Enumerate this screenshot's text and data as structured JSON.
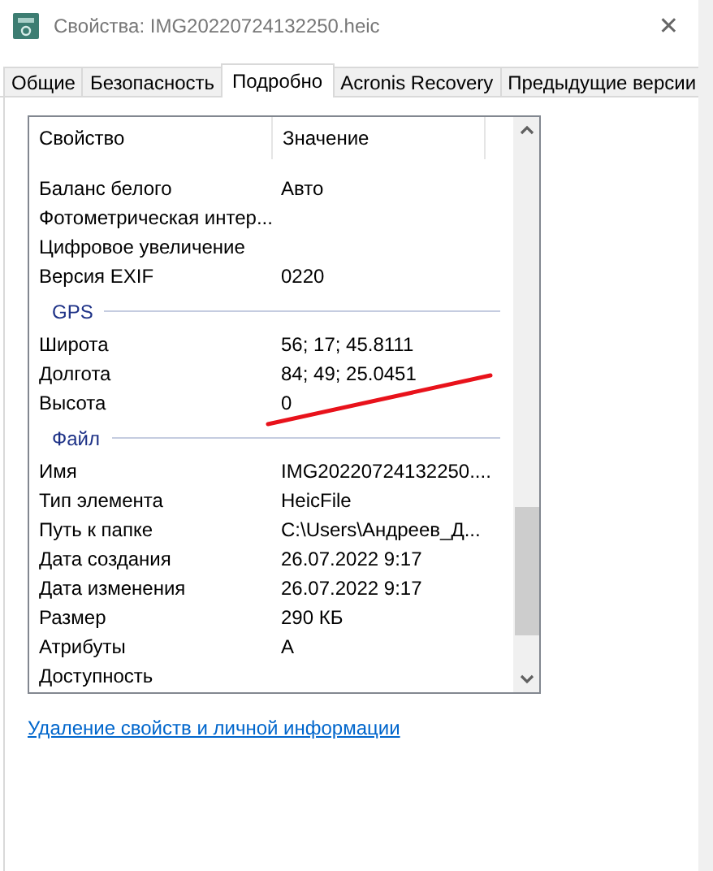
{
  "window": {
    "title": "Свойства: IMG20220724132250.heic",
    "close": "✕"
  },
  "tabs": [
    {
      "label": "Общие",
      "selected": false
    },
    {
      "label": "Безопасность",
      "selected": false
    },
    {
      "label": "Подробно",
      "selected": true
    },
    {
      "label": "Acronis Recovery",
      "selected": false
    },
    {
      "label": "Предыдущие версии",
      "selected": false
    }
  ],
  "list": {
    "columns": [
      "Свойство",
      "Значение"
    ],
    "groups": [
      {
        "rows": [
          {
            "property": "Баланс белого",
            "value": "Авто"
          },
          {
            "property": "Фотометрическая интер..."
          },
          {
            "property": "Цифровое увеличение"
          },
          {
            "property": "Версия EXIF",
            "value": "0220"
          }
        ]
      },
      {
        "name": "GPS",
        "rows": [
          {
            "property": "Широта",
            "value": "56; 17; 45.8111"
          },
          {
            "property": "Долгота",
            "value": "84; 49; 25.0451"
          },
          {
            "property": "Высота",
            "value": "0"
          }
        ]
      },
      {
        "name": "Файл",
        "rows": [
          {
            "property": "Имя",
            "value": "IMG20220724132250...."
          },
          {
            "property": "Тип элемента",
            "value": "HeicFile"
          },
          {
            "property": "Путь к папке",
            "value": "C:\\Users\\Андреев_Д..."
          },
          {
            "property": "Дата создания",
            "value": "26.07.2022 9:17"
          },
          {
            "property": "Дата изменения",
            "value": "26.07.2022 9:17"
          },
          {
            "property": "Размер",
            "value": "290 КБ"
          },
          {
            "property": "Атрибуты",
            "value": "A"
          },
          {
            "property": "Доступность"
          }
        ]
      }
    ]
  },
  "link": "Удаление свойств и личной информации"
}
